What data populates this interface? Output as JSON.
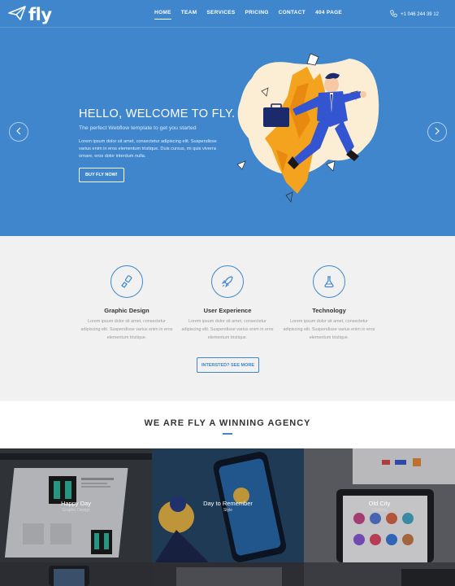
{
  "brand": {
    "name": "fly"
  },
  "nav": {
    "items": [
      {
        "label": "HOME",
        "active": true
      },
      {
        "label": "TEAM"
      },
      {
        "label": "SERVICES"
      },
      {
        "label": "PRICING"
      },
      {
        "label": "CONTACT"
      },
      {
        "label": "404 PAGE"
      }
    ],
    "phone": "+1 046 244 39 12"
  },
  "hero": {
    "title": "HELLO, WELCOME TO FLY.",
    "subtitle": "The perfect Webflow template to get you started",
    "body": "Lorem ipsum dolor sit amet, consectetur adipiscing elit. Suspendisse varius enim in eros elementum tristique. Duis cursus, mi quis viverra ornare, eros dolor interdum nulla.",
    "cta": "BUY FLY NOW!"
  },
  "services": {
    "items": [
      {
        "title": "Graphic Design",
        "icon": "brush-icon",
        "text": "Lorem ipsum dolor sit amet, consectetur adipiscing elit. Suspendisse varius enim in eros elementum tristique."
      },
      {
        "title": "User Experience",
        "icon": "rocket-icon",
        "text": "Lorem ipsum dolor sit amet, consectetur adipiscing elit. Suspendisse varius enim in eros elementum tristique."
      },
      {
        "title": "Technology",
        "icon": "flask-icon",
        "text": "Lorem ipsum dolor sit amet, consectetur adipiscing elit. Suspendisse varius enim in eros elementum tristique."
      }
    ],
    "button": "INTERSTED? SEE MORE"
  },
  "agency": {
    "title": "WE ARE FLY A WINNING AGENCY"
  },
  "gallery": {
    "items": [
      {
        "title": "Happy Day",
        "sub": "Graphic Design"
      },
      {
        "title": "Day to Remember",
        "sub": "Style"
      },
      {
        "title": "Old City",
        "sub": "Clothing"
      }
    ]
  },
  "colors": {
    "primary": "#3f86cc",
    "services_bg": "#f1f1f1",
    "accent_orange": "#f4a31e"
  }
}
